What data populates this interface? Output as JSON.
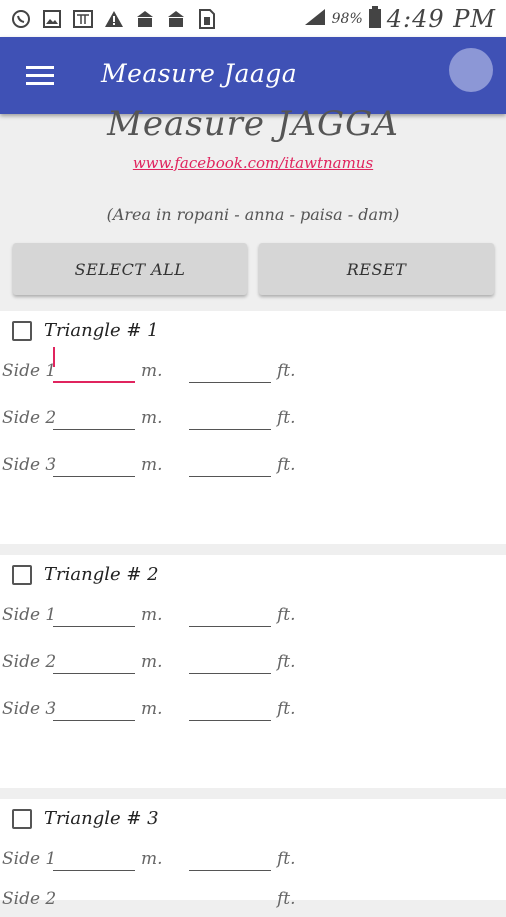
{
  "status_bar": {
    "icons": [
      "viber-icon",
      "image-icon",
      "hindi-text-icon",
      "warning-icon",
      "temple-icon",
      "temple-icon",
      "sim-icon"
    ],
    "battery_percent": "98%",
    "time": "4:49 PM"
  },
  "app_bar": {
    "title": "Measure Jaaga"
  },
  "header": {
    "title": "Measure JAGGA",
    "link": "www.facebook.com/itawtnamus",
    "area_note": "(Area in ropani - anna - paisa - dam)"
  },
  "buttons": {
    "select_all": "SELECT ALL",
    "reset": "RESET"
  },
  "units": {
    "meters": "m.",
    "feet": "ft."
  },
  "triangles": [
    {
      "title": "Triangle # 1",
      "sides": [
        "Side 1",
        "Side 2",
        "Side 3"
      ]
    },
    {
      "title": "Triangle # 2",
      "sides": [
        "Side 1",
        "Side 2",
        "Side 3"
      ]
    },
    {
      "title": "Triangle # 3",
      "sides": [
        "Side 1",
        "Side 2"
      ]
    }
  ],
  "colors": {
    "app_bar": "#3f51b5",
    "accent": "#e0245e",
    "button": "#d6d6d6"
  }
}
